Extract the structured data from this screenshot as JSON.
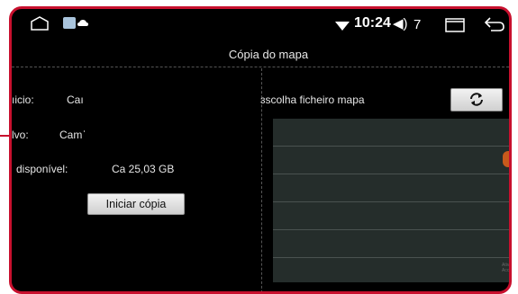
{
  "status_bar": {
    "icons": [
      "home-icon",
      "settings-app-icon",
      "cloud-icon",
      "wifi-icon",
      "volume-icon",
      "recent-apps-icon",
      "back-icon"
    ],
    "time": "10:24",
    "volume": "7"
  },
  "title": "Cópia do mapa",
  "left_panel": {
    "rows": [
      {
        "label": "ıicio:",
        "value": "Caı"
      },
      {
        "label": "lvo:",
        "value": "Camˈ"
      },
      {
        "label": "disponível:",
        "value": "Ca 25,03 GB"
      }
    ],
    "start_button": "Iniciar cópia"
  },
  "right_panel": {
    "label": "ɜscolha ficheiro mapa",
    "refresh_icon": "refresh-icon",
    "list_rows": 6
  },
  "watermark": "Ativa\nAcce",
  "colors": {
    "frame": "#c8102e",
    "background": "#000000",
    "list_background": "#252d2b"
  }
}
